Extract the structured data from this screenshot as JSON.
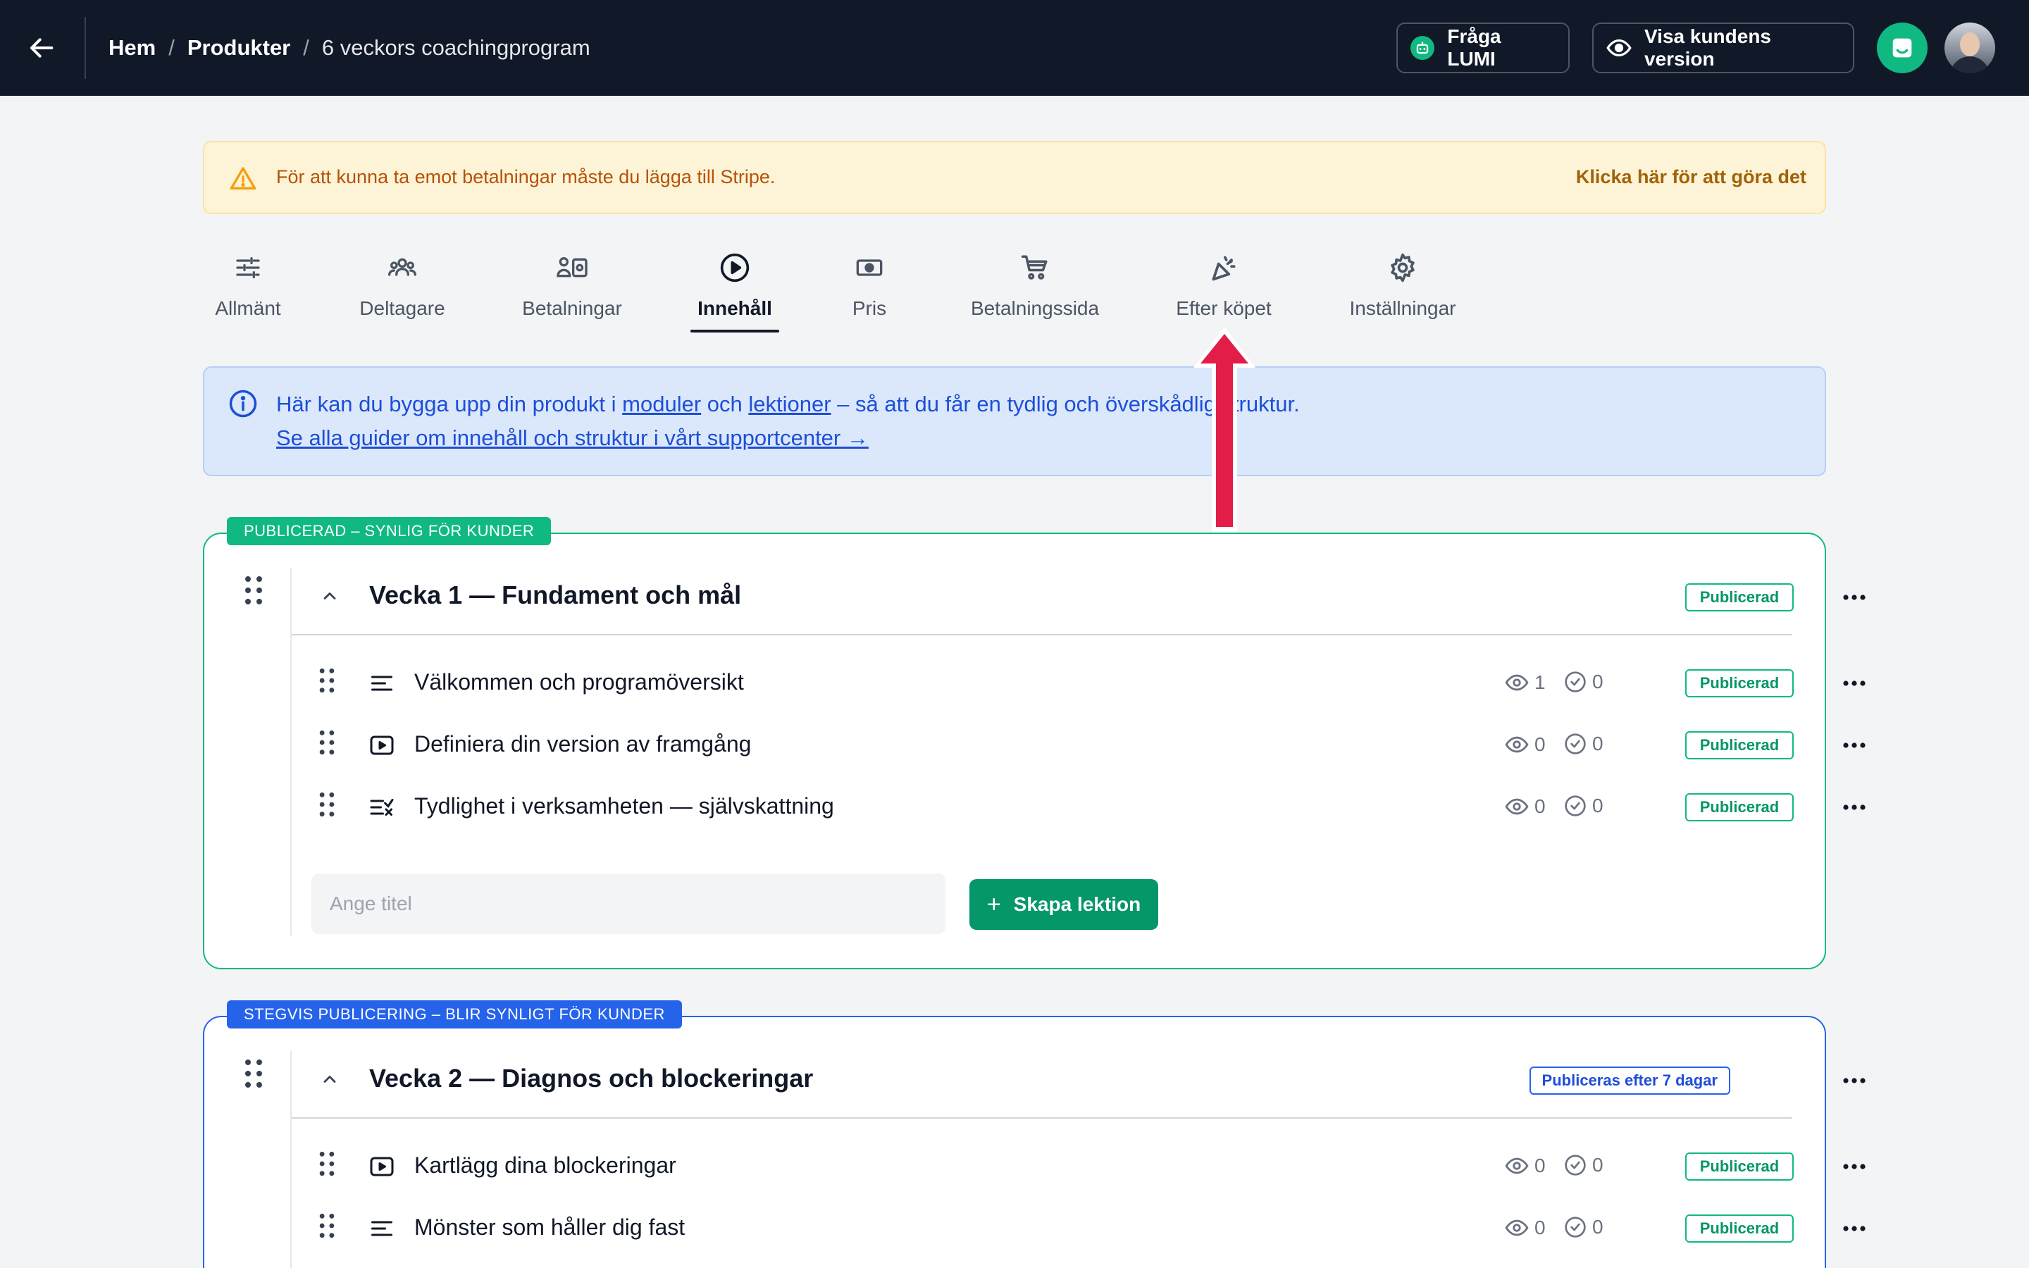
{
  "topbar": {
    "breadcrumb": [
      "Hem",
      "Produkter",
      "6 veckors coachingprogram"
    ],
    "ask_lumi": "Fråga LUMI",
    "customer_view": "Visa kundens version"
  },
  "warning": {
    "message": "För att kunna ta emot betalningar måste du lägga till Stripe.",
    "action": "Klicka här för att göra det"
  },
  "tabs": [
    {
      "label": "Allmänt",
      "icon": "sliders-icon"
    },
    {
      "label": "Deltagare",
      "icon": "users-icon"
    },
    {
      "label": "Betalningar",
      "icon": "payments-icon"
    },
    {
      "label": "Innehåll",
      "icon": "play-circle-icon",
      "active": true
    },
    {
      "label": "Pris",
      "icon": "money-icon"
    },
    {
      "label": "Betalningssida",
      "icon": "cart-icon"
    },
    {
      "label": "Efter köpet",
      "icon": "party-icon"
    },
    {
      "label": "Inställningar",
      "icon": "gear-icon"
    }
  ],
  "info": {
    "text_before": "Här kan du bygga upp din produkt i ",
    "link_modules": "moduler",
    "text_och": " och ",
    "link_lessons": "lektioner",
    "text_after": " – så att du får en tydlig och överskådlig struktur.",
    "guide_link": "Se alla guider om innehåll och struktur i vårt supportcenter →"
  },
  "modules": [
    {
      "tag": "PUBLICERAD – SYNLIG FÖR KUNDER",
      "title": "Vecka 1 — Fundament och mål",
      "status": "Publicerad",
      "lessons": [
        {
          "title": "Välkommen och programöversikt",
          "type": "text-icon",
          "views": "1",
          "completed": "0",
          "status": "Publicerad"
        },
        {
          "title": "Definiera din version av framgång",
          "type": "video-icon",
          "views": "0",
          "completed": "0",
          "status": "Publicerad"
        },
        {
          "title": "Tydlighet i verksamheten — självskattning",
          "type": "quiz-icon",
          "views": "0",
          "completed": "0",
          "status": "Publicerad"
        }
      ],
      "new_lesson_placeholder": "Ange titel",
      "create_button": "Skapa lektion"
    },
    {
      "tag": "STEGVIS PUBLICERING – BLIR SYNLIGT FÖR KUNDER",
      "title": "Vecka 2 — Diagnos och blockeringar",
      "status": "Publiceras efter 7 dagar",
      "lessons": [
        {
          "title": "Kartlägg dina blockeringar",
          "type": "video-icon",
          "views": "0",
          "completed": "0",
          "status": "Publicerad"
        },
        {
          "title": "Mönster som håller dig fast",
          "type": "text-icon",
          "views": "0",
          "completed": "0",
          "status": "Publicerad"
        }
      ]
    }
  ],
  "colors": {
    "accent_green": "#10b981",
    "accent_blue": "#2563eb",
    "annotation_arrow": "#e11d48",
    "topbar": "#111827"
  }
}
